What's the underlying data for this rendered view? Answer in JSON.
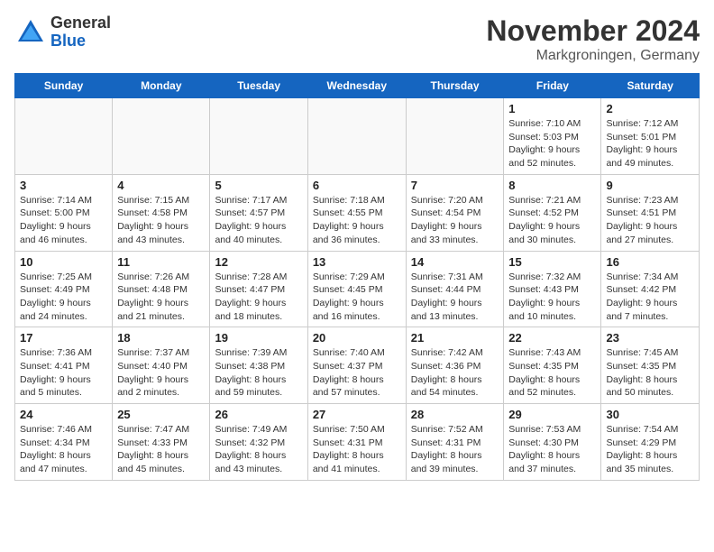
{
  "logo": {
    "general": "General",
    "blue": "Blue"
  },
  "title": {
    "month": "November 2024",
    "location": "Markgroningen, Germany"
  },
  "weekdays": [
    "Sunday",
    "Monday",
    "Tuesday",
    "Wednesday",
    "Thursday",
    "Friday",
    "Saturday"
  ],
  "weeks": [
    [
      {
        "day": "",
        "info": ""
      },
      {
        "day": "",
        "info": ""
      },
      {
        "day": "",
        "info": ""
      },
      {
        "day": "",
        "info": ""
      },
      {
        "day": "",
        "info": ""
      },
      {
        "day": "1",
        "info": "Sunrise: 7:10 AM\nSunset: 5:03 PM\nDaylight: 9 hours\nand 52 minutes."
      },
      {
        "day": "2",
        "info": "Sunrise: 7:12 AM\nSunset: 5:01 PM\nDaylight: 9 hours\nand 49 minutes."
      }
    ],
    [
      {
        "day": "3",
        "info": "Sunrise: 7:14 AM\nSunset: 5:00 PM\nDaylight: 9 hours\nand 46 minutes."
      },
      {
        "day": "4",
        "info": "Sunrise: 7:15 AM\nSunset: 4:58 PM\nDaylight: 9 hours\nand 43 minutes."
      },
      {
        "day": "5",
        "info": "Sunrise: 7:17 AM\nSunset: 4:57 PM\nDaylight: 9 hours\nand 40 minutes."
      },
      {
        "day": "6",
        "info": "Sunrise: 7:18 AM\nSunset: 4:55 PM\nDaylight: 9 hours\nand 36 minutes."
      },
      {
        "day": "7",
        "info": "Sunrise: 7:20 AM\nSunset: 4:54 PM\nDaylight: 9 hours\nand 33 minutes."
      },
      {
        "day": "8",
        "info": "Sunrise: 7:21 AM\nSunset: 4:52 PM\nDaylight: 9 hours\nand 30 minutes."
      },
      {
        "day": "9",
        "info": "Sunrise: 7:23 AM\nSunset: 4:51 PM\nDaylight: 9 hours\nand 27 minutes."
      }
    ],
    [
      {
        "day": "10",
        "info": "Sunrise: 7:25 AM\nSunset: 4:49 PM\nDaylight: 9 hours\nand 24 minutes."
      },
      {
        "day": "11",
        "info": "Sunrise: 7:26 AM\nSunset: 4:48 PM\nDaylight: 9 hours\nand 21 minutes."
      },
      {
        "day": "12",
        "info": "Sunrise: 7:28 AM\nSunset: 4:47 PM\nDaylight: 9 hours\nand 18 minutes."
      },
      {
        "day": "13",
        "info": "Sunrise: 7:29 AM\nSunset: 4:45 PM\nDaylight: 9 hours\nand 16 minutes."
      },
      {
        "day": "14",
        "info": "Sunrise: 7:31 AM\nSunset: 4:44 PM\nDaylight: 9 hours\nand 13 minutes."
      },
      {
        "day": "15",
        "info": "Sunrise: 7:32 AM\nSunset: 4:43 PM\nDaylight: 9 hours\nand 10 minutes."
      },
      {
        "day": "16",
        "info": "Sunrise: 7:34 AM\nSunset: 4:42 PM\nDaylight: 9 hours\nand 7 minutes."
      }
    ],
    [
      {
        "day": "17",
        "info": "Sunrise: 7:36 AM\nSunset: 4:41 PM\nDaylight: 9 hours\nand 5 minutes."
      },
      {
        "day": "18",
        "info": "Sunrise: 7:37 AM\nSunset: 4:40 PM\nDaylight: 9 hours\nand 2 minutes."
      },
      {
        "day": "19",
        "info": "Sunrise: 7:39 AM\nSunset: 4:38 PM\nDaylight: 8 hours\nand 59 minutes."
      },
      {
        "day": "20",
        "info": "Sunrise: 7:40 AM\nSunset: 4:37 PM\nDaylight: 8 hours\nand 57 minutes."
      },
      {
        "day": "21",
        "info": "Sunrise: 7:42 AM\nSunset: 4:36 PM\nDaylight: 8 hours\nand 54 minutes."
      },
      {
        "day": "22",
        "info": "Sunrise: 7:43 AM\nSunset: 4:35 PM\nDaylight: 8 hours\nand 52 minutes."
      },
      {
        "day": "23",
        "info": "Sunrise: 7:45 AM\nSunset: 4:35 PM\nDaylight: 8 hours\nand 50 minutes."
      }
    ],
    [
      {
        "day": "24",
        "info": "Sunrise: 7:46 AM\nSunset: 4:34 PM\nDaylight: 8 hours\nand 47 minutes."
      },
      {
        "day": "25",
        "info": "Sunrise: 7:47 AM\nSunset: 4:33 PM\nDaylight: 8 hours\nand 45 minutes."
      },
      {
        "day": "26",
        "info": "Sunrise: 7:49 AM\nSunset: 4:32 PM\nDaylight: 8 hours\nand 43 minutes."
      },
      {
        "day": "27",
        "info": "Sunrise: 7:50 AM\nSunset: 4:31 PM\nDaylight: 8 hours\nand 41 minutes."
      },
      {
        "day": "28",
        "info": "Sunrise: 7:52 AM\nSunset: 4:31 PM\nDaylight: 8 hours\nand 39 minutes."
      },
      {
        "day": "29",
        "info": "Sunrise: 7:53 AM\nSunset: 4:30 PM\nDaylight: 8 hours\nand 37 minutes."
      },
      {
        "day": "30",
        "info": "Sunrise: 7:54 AM\nSunset: 4:29 PM\nDaylight: 8 hours\nand 35 minutes."
      }
    ]
  ]
}
